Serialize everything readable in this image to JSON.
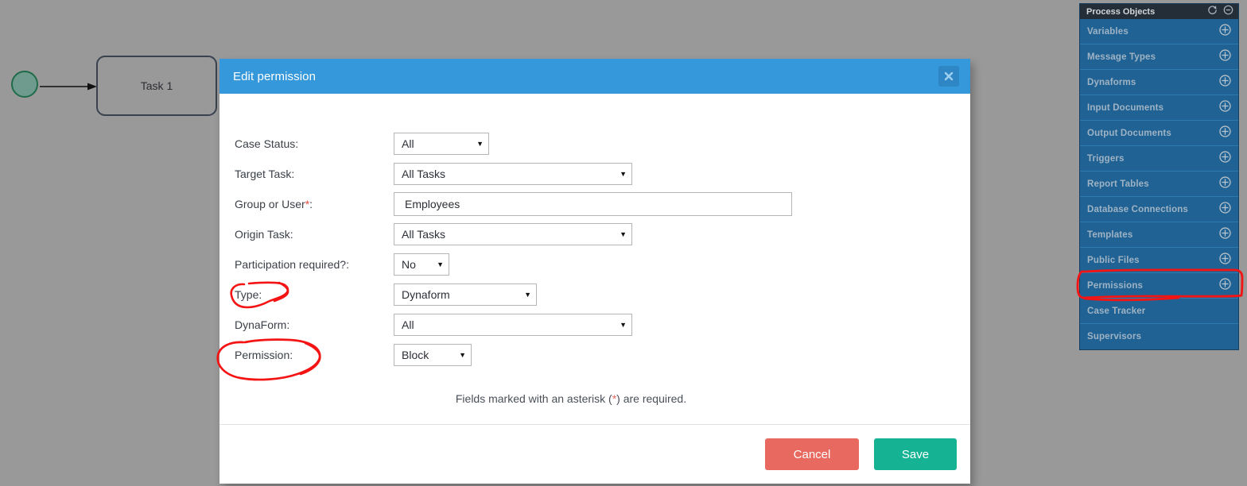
{
  "canvas": {
    "start_event_name": "start-event",
    "task": {
      "label": "Task 1"
    }
  },
  "dialog": {
    "title": "Edit permission",
    "close_icon": "close-icon",
    "header_color": "#3498db",
    "fields": [
      {
        "label": "Case Status:",
        "control": "select",
        "value": "All",
        "name": "case-status"
      },
      {
        "label": "Target Task:",
        "control": "select",
        "value": "All Tasks",
        "name": "target-task"
      },
      {
        "label": "Group or User",
        "label_suffix": ":",
        "required": true,
        "control": "text",
        "value": "Employees",
        "name": "group-or-user"
      },
      {
        "label": "Origin Task:",
        "control": "select",
        "value": "All Tasks",
        "name": "origin-task"
      },
      {
        "label": "Participation required?:",
        "control": "select",
        "value": "No",
        "name": "participation-required"
      },
      {
        "label": "Type:",
        "control": "select",
        "value": "Dynaform",
        "name": "type"
      },
      {
        "label": "DynaForm:",
        "control": "select",
        "value": "All",
        "name": "dynaform"
      },
      {
        "label": "Permission:",
        "control": "select",
        "value": "Block",
        "name": "permission"
      }
    ],
    "required_note_before": "Fields marked with an asterisk (",
    "required_note_star": "*",
    "required_note_after": ") are required.",
    "buttons": {
      "cancel": {
        "label": "Cancel",
        "color": "#e8695f"
      },
      "save": {
        "label": "Save",
        "color": "#16b294"
      }
    }
  },
  "sidebar": {
    "title": "Process Objects",
    "header_icons": [
      "refresh-icon",
      "minimize-icon"
    ],
    "background_color": "#1f6293",
    "items": [
      {
        "label": "Variables",
        "has_add": true
      },
      {
        "label": "Message Types",
        "has_add": true
      },
      {
        "label": "Dynaforms",
        "has_add": true
      },
      {
        "label": "Input Documents",
        "has_add": true
      },
      {
        "label": "Output Documents",
        "has_add": true
      },
      {
        "label": "Triggers",
        "has_add": true
      },
      {
        "label": "Report Tables",
        "has_add": true
      },
      {
        "label": "Database Connections",
        "has_add": true
      },
      {
        "label": "Templates",
        "has_add": true
      },
      {
        "label": "Public Files",
        "has_add": true
      },
      {
        "label": "Permissions",
        "has_add": true,
        "highlighted": true
      },
      {
        "label": "Case Tracker",
        "has_add": false
      },
      {
        "label": "Supervisors",
        "has_add": false
      }
    ]
  },
  "annotations": {
    "color": "#f41414",
    "marks": [
      {
        "name": "type-label-circle",
        "shape": "ellipse-freehand"
      },
      {
        "name": "permission-label-circle",
        "shape": "ellipse-freehand"
      },
      {
        "name": "sidebar-permissions-rectangle",
        "shape": "rectangle-freehand"
      }
    ]
  }
}
